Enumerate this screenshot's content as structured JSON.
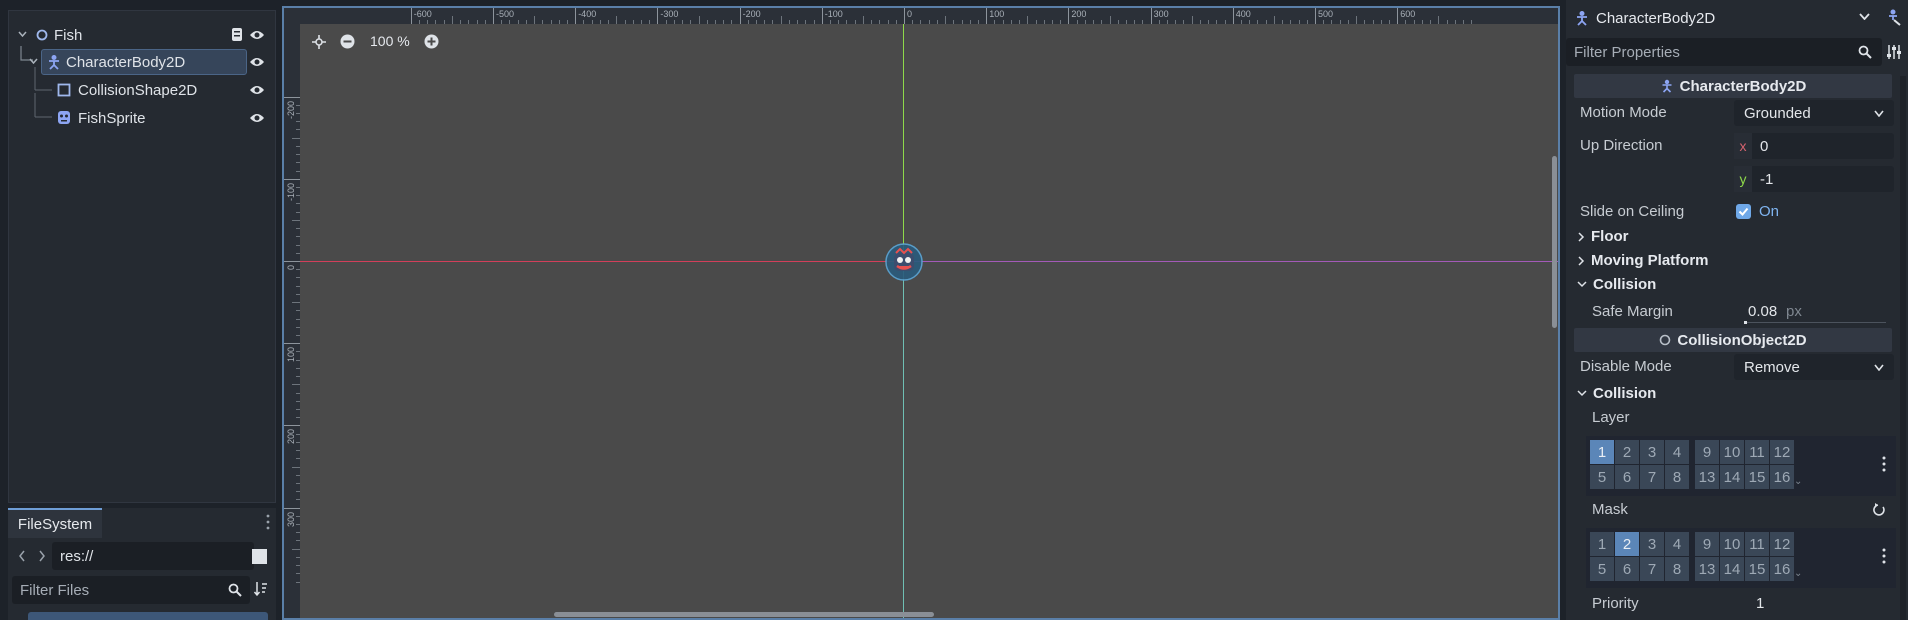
{
  "scene_tree": {
    "nodes": [
      {
        "label": "Fish",
        "icon": "node2d-circle-icon"
      },
      {
        "label": "CharacterBody2D",
        "icon": "character-body-icon"
      },
      {
        "label": "CollisionShape2D",
        "icon": "collision-shape-icon"
      },
      {
        "label": "FishSprite",
        "icon": "sprite-icon"
      }
    ]
  },
  "filesystem": {
    "tab_label": "FileSystem",
    "path_value": "res://",
    "filter_placeholder": "Filter Files"
  },
  "viewport": {
    "zoom_label": "100 %",
    "ruler_h_labels": [
      "-600",
      "-500",
      "-400",
      "-300",
      "-200",
      "-100",
      "0",
      "100",
      "200",
      "300",
      "400",
      "500",
      "600"
    ],
    "ruler_v_labels": [
      "-200",
      "-100",
      "0",
      "100",
      "200",
      "300"
    ]
  },
  "inspector": {
    "node_title": "CharacterBody2D",
    "filter_placeholder": "Filter Properties",
    "section_character": "CharacterBody2D",
    "motion_mode_label": "Motion Mode",
    "motion_mode_value": "Grounded",
    "up_direction_label": "Up Direction",
    "up_x_label": "x",
    "up_x_value": "0",
    "up_y_label": "y",
    "up_y_value": "-1",
    "slide_label": "Slide on Ceiling",
    "slide_value": "On",
    "group_floor": "Floor",
    "group_moving_platform": "Moving Platform",
    "group_collision": "Collision",
    "safe_margin_label": "Safe Margin",
    "safe_margin_value": "0.08",
    "safe_margin_unit": "px",
    "section_collision_object": "CollisionObject2D",
    "disable_mode_label": "Disable Mode",
    "disable_mode_value": "Remove",
    "group_collision2": "Collision",
    "layer_label": "Layer",
    "mask_label": "Mask",
    "priority_label": "Priority",
    "priority_value": "1",
    "layer_cells": [
      "1",
      "2",
      "3",
      "4",
      "9",
      "10",
      "11",
      "12",
      "5",
      "6",
      "7",
      "8",
      "13",
      "14",
      "15",
      "16"
    ],
    "layer_active": [
      1
    ],
    "mask_active": [
      2
    ]
  },
  "colors": {
    "accent": "#5b86b8",
    "axis_x": "#d23f5a",
    "axis_y": "#8ed94a"
  }
}
